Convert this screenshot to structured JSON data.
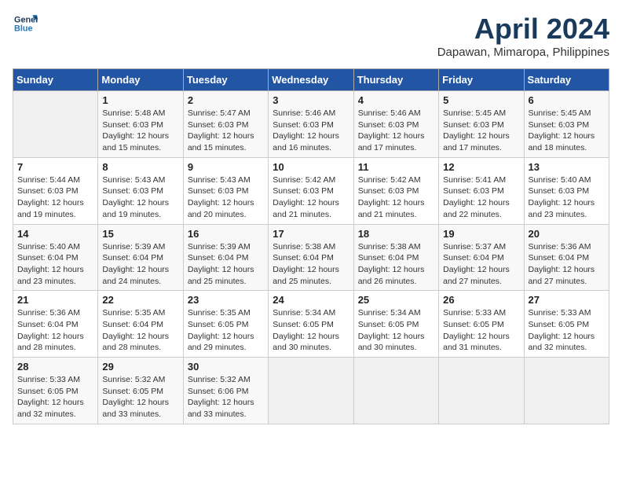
{
  "header": {
    "logo_line1": "General",
    "logo_line2": "Blue",
    "month_title": "April 2024",
    "location": "Dapawan, Mimaropa, Philippines"
  },
  "weekdays": [
    "Sunday",
    "Monday",
    "Tuesday",
    "Wednesday",
    "Thursday",
    "Friday",
    "Saturday"
  ],
  "weeks": [
    [
      {
        "day": "",
        "info": ""
      },
      {
        "day": "1",
        "info": "Sunrise: 5:48 AM\nSunset: 6:03 PM\nDaylight: 12 hours\nand 15 minutes."
      },
      {
        "day": "2",
        "info": "Sunrise: 5:47 AM\nSunset: 6:03 PM\nDaylight: 12 hours\nand 15 minutes."
      },
      {
        "day": "3",
        "info": "Sunrise: 5:46 AM\nSunset: 6:03 PM\nDaylight: 12 hours\nand 16 minutes."
      },
      {
        "day": "4",
        "info": "Sunrise: 5:46 AM\nSunset: 6:03 PM\nDaylight: 12 hours\nand 17 minutes."
      },
      {
        "day": "5",
        "info": "Sunrise: 5:45 AM\nSunset: 6:03 PM\nDaylight: 12 hours\nand 17 minutes."
      },
      {
        "day": "6",
        "info": "Sunrise: 5:45 AM\nSunset: 6:03 PM\nDaylight: 12 hours\nand 18 minutes."
      }
    ],
    [
      {
        "day": "7",
        "info": "Sunrise: 5:44 AM\nSunset: 6:03 PM\nDaylight: 12 hours\nand 19 minutes."
      },
      {
        "day": "8",
        "info": "Sunrise: 5:43 AM\nSunset: 6:03 PM\nDaylight: 12 hours\nand 19 minutes."
      },
      {
        "day": "9",
        "info": "Sunrise: 5:43 AM\nSunset: 6:03 PM\nDaylight: 12 hours\nand 20 minutes."
      },
      {
        "day": "10",
        "info": "Sunrise: 5:42 AM\nSunset: 6:03 PM\nDaylight: 12 hours\nand 21 minutes."
      },
      {
        "day": "11",
        "info": "Sunrise: 5:42 AM\nSunset: 6:03 PM\nDaylight: 12 hours\nand 21 minutes."
      },
      {
        "day": "12",
        "info": "Sunrise: 5:41 AM\nSunset: 6:03 PM\nDaylight: 12 hours\nand 22 minutes."
      },
      {
        "day": "13",
        "info": "Sunrise: 5:40 AM\nSunset: 6:03 PM\nDaylight: 12 hours\nand 23 minutes."
      }
    ],
    [
      {
        "day": "14",
        "info": "Sunrise: 5:40 AM\nSunset: 6:04 PM\nDaylight: 12 hours\nand 23 minutes."
      },
      {
        "day": "15",
        "info": "Sunrise: 5:39 AM\nSunset: 6:04 PM\nDaylight: 12 hours\nand 24 minutes."
      },
      {
        "day": "16",
        "info": "Sunrise: 5:39 AM\nSunset: 6:04 PM\nDaylight: 12 hours\nand 25 minutes."
      },
      {
        "day": "17",
        "info": "Sunrise: 5:38 AM\nSunset: 6:04 PM\nDaylight: 12 hours\nand 25 minutes."
      },
      {
        "day": "18",
        "info": "Sunrise: 5:38 AM\nSunset: 6:04 PM\nDaylight: 12 hours\nand 26 minutes."
      },
      {
        "day": "19",
        "info": "Sunrise: 5:37 AM\nSunset: 6:04 PM\nDaylight: 12 hours\nand 27 minutes."
      },
      {
        "day": "20",
        "info": "Sunrise: 5:36 AM\nSunset: 6:04 PM\nDaylight: 12 hours\nand 27 minutes."
      }
    ],
    [
      {
        "day": "21",
        "info": "Sunrise: 5:36 AM\nSunset: 6:04 PM\nDaylight: 12 hours\nand 28 minutes."
      },
      {
        "day": "22",
        "info": "Sunrise: 5:35 AM\nSunset: 6:04 PM\nDaylight: 12 hours\nand 28 minutes."
      },
      {
        "day": "23",
        "info": "Sunrise: 5:35 AM\nSunset: 6:05 PM\nDaylight: 12 hours\nand 29 minutes."
      },
      {
        "day": "24",
        "info": "Sunrise: 5:34 AM\nSunset: 6:05 PM\nDaylight: 12 hours\nand 30 minutes."
      },
      {
        "day": "25",
        "info": "Sunrise: 5:34 AM\nSunset: 6:05 PM\nDaylight: 12 hours\nand 30 minutes."
      },
      {
        "day": "26",
        "info": "Sunrise: 5:33 AM\nSunset: 6:05 PM\nDaylight: 12 hours\nand 31 minutes."
      },
      {
        "day": "27",
        "info": "Sunrise: 5:33 AM\nSunset: 6:05 PM\nDaylight: 12 hours\nand 32 minutes."
      }
    ],
    [
      {
        "day": "28",
        "info": "Sunrise: 5:33 AM\nSunset: 6:05 PM\nDaylight: 12 hours\nand 32 minutes."
      },
      {
        "day": "29",
        "info": "Sunrise: 5:32 AM\nSunset: 6:05 PM\nDaylight: 12 hours\nand 33 minutes."
      },
      {
        "day": "30",
        "info": "Sunrise: 5:32 AM\nSunset: 6:06 PM\nDaylight: 12 hours\nand 33 minutes."
      },
      {
        "day": "",
        "info": ""
      },
      {
        "day": "",
        "info": ""
      },
      {
        "day": "",
        "info": ""
      },
      {
        "day": "",
        "info": ""
      }
    ]
  ]
}
